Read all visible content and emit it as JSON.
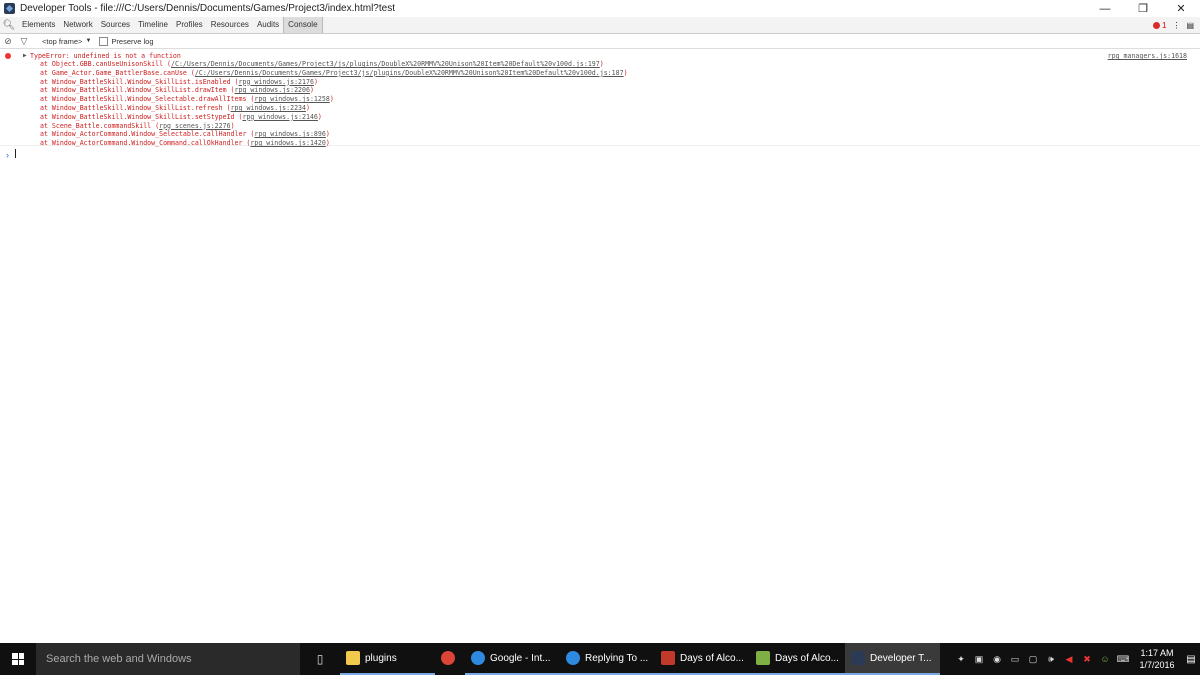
{
  "window": {
    "title": "Developer Tools - file:///C:/Users/Dennis/Documents/Games/Project3/index.html?test",
    "controls": {
      "minimize": "—",
      "restore": "❐",
      "close": "✕"
    }
  },
  "devtools_tabs": [
    "Elements",
    "Network",
    "Sources",
    "Timeline",
    "Profiles",
    "Resources",
    "Audits",
    "Console"
  ],
  "active_tab": "Console",
  "error_count": "1",
  "toolbar": {
    "frame_selector": "<top frame>",
    "frame_arrow": "▼",
    "preserve_log": "Preserve log"
  },
  "console": {
    "error_message": "TypeError: undefined is not a function",
    "source": "rpg_managers.js:1618",
    "stack": [
      {
        "at": "at Object.GBB.canUseUnisonSkill (",
        "link": "/C:/Users/Dennis/Documents/Games/Project3/js/plugins/DoubleX%20RMMV%20Unison%20Item%20Default%20v100d.js:197",
        "end": ")"
      },
      {
        "at": "at Game_Actor.Game_BattlerBase.canUse (",
        "link": "/C:/Users/Dennis/Documents/Games/Project3/js/plugins/DoubleX%20RMMV%20Unison%20Item%20Default%20v100d.js:187",
        "end": ")"
      },
      {
        "at": "at Window_BattleSkill.Window_SkillList.isEnabled (",
        "link": "rpg_windows.js:2176",
        "end": ")"
      },
      {
        "at": "at Window_BattleSkill.Window_SkillList.drawItem (",
        "link": "rpg_windows.js:2206",
        "end": ")"
      },
      {
        "at": "at Window_BattleSkill.Window_Selectable.drawAllItems (",
        "link": "rpg_windows.js:1258",
        "end": ")"
      },
      {
        "at": "at Window_BattleSkill.Window_SkillList.refresh (",
        "link": "rpg_windows.js:2234",
        "end": ")"
      },
      {
        "at": "at Window_BattleSkill.Window_SkillList.setStypeId (",
        "link": "rpg_windows.js:2146",
        "end": ")"
      },
      {
        "at": "at Scene_Battle.commandSkill (",
        "link": "rpg_scenes.js:2276",
        "end": ")"
      },
      {
        "at": "at Window_ActorCommand.Window_Selectable.callHandler (",
        "link": "rpg_windows.js:896",
        "end": ")"
      },
      {
        "at": "at Window_ActorCommand.Window_Command.callOkHandler (",
        "link": "rpg_windows.js:1420",
        "end": ")"
      }
    ],
    "prompt": "›"
  },
  "taskbar": {
    "search_placeholder": "Search the web and Windows",
    "items": [
      {
        "label": "plugins",
        "icon": "folder-icon",
        "color": "#f2c94c",
        "state": "open"
      },
      {
        "label": "",
        "icon": "chrome-icon",
        "color": "#db4437",
        "state": "pinned"
      },
      {
        "label": "Google - Int...",
        "icon": "ie-icon",
        "color": "#2d8ae0",
        "state": "open"
      },
      {
        "label": "Replying To ...",
        "icon": "ie-icon",
        "color": "#2d8ae0",
        "state": "open"
      },
      {
        "label": "Days of Alco...",
        "icon": "game-icon",
        "color": "#c0392b",
        "state": "open"
      },
      {
        "label": "Days of Alco...",
        "icon": "game-icon",
        "color": "#7fb046",
        "state": "open"
      },
      {
        "label": "Developer T...",
        "icon": "devtools-icon",
        "color": "#2b3a55",
        "state": "active"
      }
    ],
    "clock": {
      "time": "1:17 AM",
      "date": "1/7/2016"
    }
  },
  "colors": {
    "error": "#d02020",
    "accent": "#7aa9e6",
    "taskbar": "#101010"
  }
}
